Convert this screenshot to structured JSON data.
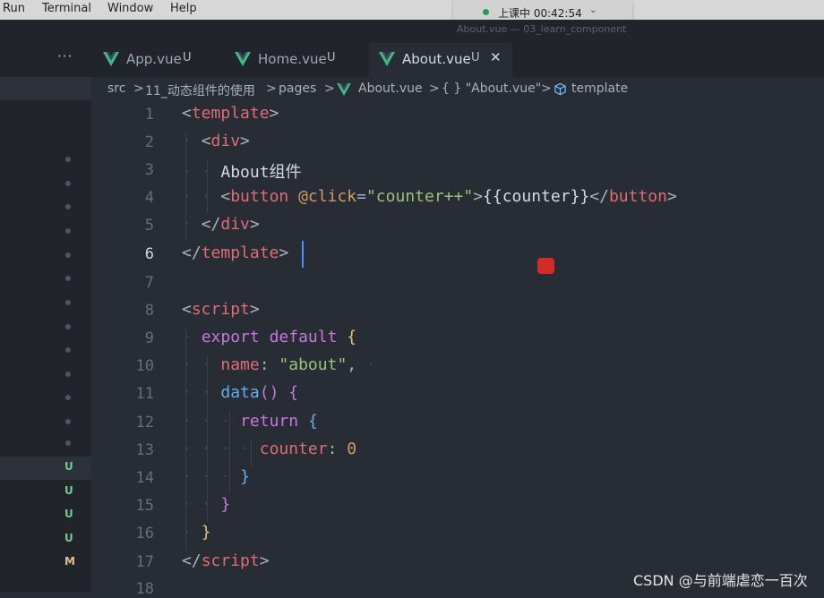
{
  "menubar": {
    "items": [
      "Run",
      "Terminal",
      "Window",
      "Help"
    ]
  },
  "status_pill": {
    "text": "上课中 00:42:54",
    "chevron": "⌄",
    "dot_color": "#1e9c5a"
  },
  "window_title": "About.vue — 03_learn_component",
  "tabs": {
    "more": "···",
    "items": [
      {
        "label": "App.vue",
        "badge": "U",
        "active": false
      },
      {
        "label": "Home.vue",
        "badge": "U",
        "active": false
      },
      {
        "label": "About.vue",
        "badge": "U",
        "active": true,
        "close": "✕"
      }
    ]
  },
  "breadcrumb": {
    "parts": [
      "src",
      "11_动态组件的使用",
      "pages",
      "About.vue",
      "{ } \"About.vue\"",
      "template"
    ],
    "sep": ">"
  },
  "gutter_letters": [
    {
      "text": "U",
      "color": "#73c991"
    },
    {
      "text": "U",
      "color": "#73c991"
    },
    {
      "text": "U",
      "color": "#73c991"
    },
    {
      "text": "U",
      "color": "#73c991"
    },
    {
      "text": "M",
      "color": "#e2c08d"
    }
  ],
  "editor": {
    "line_numbers": [
      "1",
      "2",
      "3",
      "4",
      "5",
      "6",
      "7",
      "8",
      "9",
      "10",
      "11",
      "12",
      "13",
      "14",
      "15",
      "16",
      "17",
      "18"
    ],
    "current_line": "6",
    "code": {
      "l1": {
        "open": "<",
        "tag": "template",
        "close": ">"
      },
      "l2": {
        "open": "<",
        "tag": "div",
        "close": ">"
      },
      "l3": {
        "text": "About组件"
      },
      "l4": {
        "open": "<",
        "tag": "button",
        "attr": "@click",
        "eq": "=",
        "value": "\"counter++\"",
        "close": ">",
        "mustache": "{{counter}}",
        "endopen": "</",
        "endtag": "button",
        "endclose": ">"
      },
      "l5": {
        "open": "</",
        "tag": "div",
        "close": ">"
      },
      "l6": {
        "open": "</",
        "tag": "template",
        "close": ">"
      },
      "l8": {
        "open": "<",
        "tag": "script",
        "close": ">"
      },
      "l9": {
        "kw1": "export",
        "kw2": "default",
        "brace": "{"
      },
      "l10": {
        "prop": "name",
        "colon": ":",
        "value": "\"about\"",
        "comma": ","
      },
      "l11": {
        "fn": "data",
        "parens": "()",
        "brace": "{"
      },
      "l12": {
        "kw": "return",
        "brace": "{"
      },
      "l13": {
        "prop": "counter",
        "colon": ":",
        "value": "0"
      },
      "l14": {
        "brace": "}"
      },
      "l15": {
        "brace": "}"
      },
      "l16": {
        "brace": "}"
      },
      "l17": {
        "open": "</",
        "tag": "script",
        "close": ">"
      }
    }
  },
  "watermark": "CSDN @与前端虐恋一百次",
  "colors": {
    "accent_vue": "#42b883",
    "cursor": "#528bff",
    "record_dot": "#d42a2a"
  }
}
